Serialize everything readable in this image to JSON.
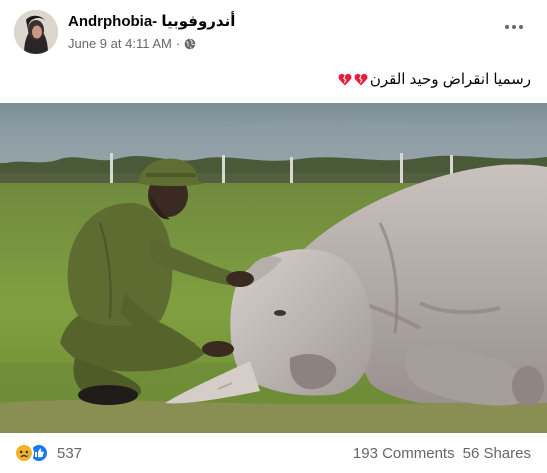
{
  "post": {
    "author": "Andrphobia- أندروفوبيا",
    "timestamp": "June 9 at 4:11 AM",
    "separator": "·",
    "privacy_icon": "globe-icon",
    "caption_text": "رسميا انقراض وحيد القرن",
    "caption_emoji": [
      "broken-heart-icon",
      "broken-heart-icon"
    ],
    "photo_description_icon": "photo",
    "reactions": {
      "types": [
        "sad",
        "like"
      ],
      "count": "537"
    },
    "comments": "193 Comments",
    "shares": "56 Shares"
  },
  "colors": {
    "secondary_text": "#65676b",
    "like_blue": "#1877f2",
    "sad_yellow": "#f7b125",
    "heart_red": "#e41e3f"
  }
}
